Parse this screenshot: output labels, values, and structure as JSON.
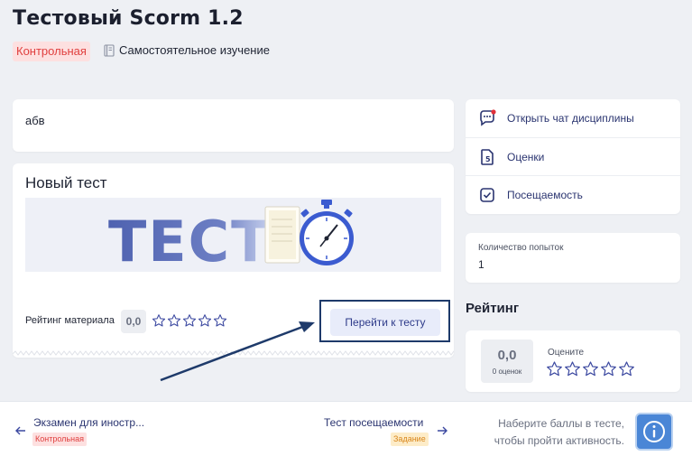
{
  "header": {
    "title": "Тестовый Scorm 1.2",
    "tag": "Контрольная",
    "study_mode": "Самостоятельное изучение"
  },
  "abv_card": {
    "text": "абв"
  },
  "test_card": {
    "title": "Новый тест",
    "banner_text": "ТЕСТ",
    "rating_label": "Рейтинг материала",
    "rating_value": "0,0",
    "stars_filled": 0,
    "stars_total": 5,
    "goto_button": "Перейти к тесту"
  },
  "side_menu": {
    "items": [
      {
        "label": "Открыть чат дисциплины",
        "icon": "chat-icon"
      },
      {
        "label": "Оценки",
        "icon": "grades-document-icon"
      },
      {
        "label": "Посещаемость",
        "icon": "checkbox-icon"
      }
    ]
  },
  "attempts": {
    "label": "Количество попыток",
    "value": "1"
  },
  "rating": {
    "heading": "Рейтинг",
    "value": "0,0",
    "count": "0 оценок",
    "rate_label": "Оцените",
    "stars_filled": 0,
    "stars_total": 5
  },
  "footer": {
    "prev": {
      "title": "Экзамен для иностр...",
      "tag": "Контрольная"
    },
    "next": {
      "title": "Тест посещаемости",
      "tag": "Задание"
    },
    "hint": "Наберите баллы в тесте, чтобы пройти активность.",
    "info_icon": "info-icon"
  },
  "colors": {
    "accent": "#2e3b8a",
    "control_tag_bg": "#fde0e0",
    "control_tag_text": "#e0403f",
    "task_tag_bg": "#fdecc8",
    "info_button": "#4a86d6",
    "annotation": "#1e3a6a"
  }
}
